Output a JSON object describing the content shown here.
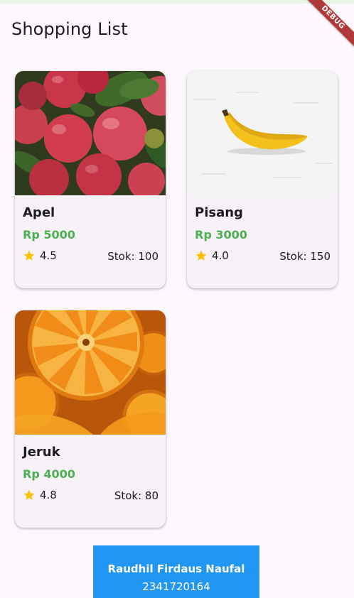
{
  "app_bar": {
    "title": "Shopping List"
  },
  "debug_banner": {
    "label": "DEBUG"
  },
  "products": [
    {
      "name": "Apel",
      "price": "Rp 5000",
      "rating": "4.5",
      "stock": "Stok: 100",
      "image": "apples"
    },
    {
      "name": "Pisang",
      "price": "Rp 3000",
      "rating": "4.0",
      "stock": "Stok: 150",
      "image": "banana"
    },
    {
      "name": "Jeruk",
      "price": "Rp 4000",
      "rating": "4.8",
      "stock": "Stok: 80",
      "image": "orange-slices"
    }
  ],
  "footer": {
    "name": "Raudhil Firdaus Naufal",
    "student_id": "2341720164"
  },
  "colors": {
    "price": "#4caf50",
    "star": "#ffc107",
    "footer": "#2196f3",
    "background": "#fdf7fe"
  }
}
